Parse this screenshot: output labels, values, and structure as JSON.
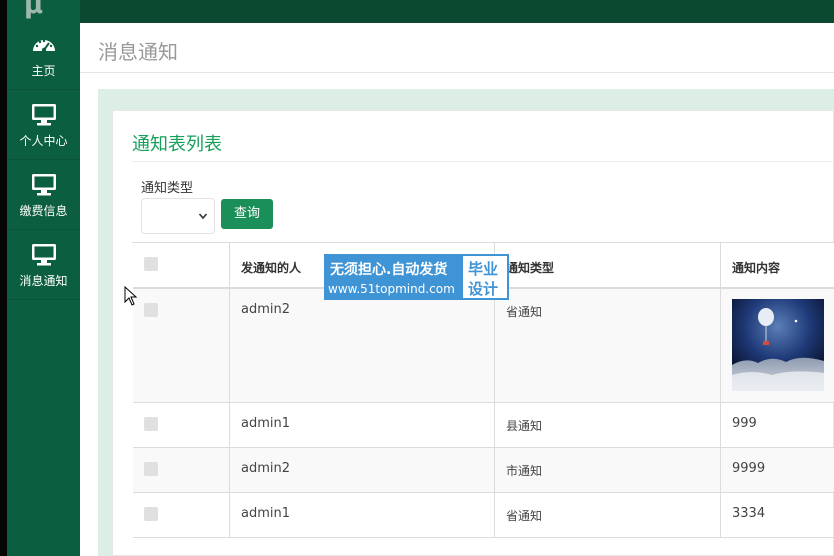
{
  "sidebar": {
    "logo_text": "μ",
    "items": [
      {
        "label": "主页",
        "icon": "dashboard-icon"
      },
      {
        "label": "个人中心",
        "icon": "monitor-icon"
      },
      {
        "label": "缴费信息",
        "icon": "monitor-icon"
      },
      {
        "label": "消息通知",
        "icon": "monitor-icon"
      }
    ]
  },
  "header": {
    "title": "消息通知"
  },
  "card": {
    "title": "通知表列表"
  },
  "filter": {
    "label": "通知类型",
    "select_value": "",
    "search_label": "查询"
  },
  "table": {
    "columns": [
      "",
      "发通知的人",
      "通知类型",
      "通知内容"
    ],
    "rows": [
      {
        "sender": "admin2",
        "type": "省通知",
        "content": "",
        "has_image": true
      },
      {
        "sender": "admin1",
        "type": "县通知",
        "content": "999"
      },
      {
        "sender": "admin2",
        "type": "市通知",
        "content": "9999"
      },
      {
        "sender": "admin1",
        "type": "省通知",
        "content": "3334"
      }
    ]
  },
  "watermark": {
    "line1": "无须担心.自动发货",
    "line2": "www.51topmind.com",
    "right1": "毕业",
    "right2": "设计"
  },
  "colors": {
    "sidebar": "#0b5e3f",
    "topbar": "#0b4a30",
    "accent": "#17a05a",
    "button": "#1a8f57",
    "watermark": "#3f94d6"
  }
}
